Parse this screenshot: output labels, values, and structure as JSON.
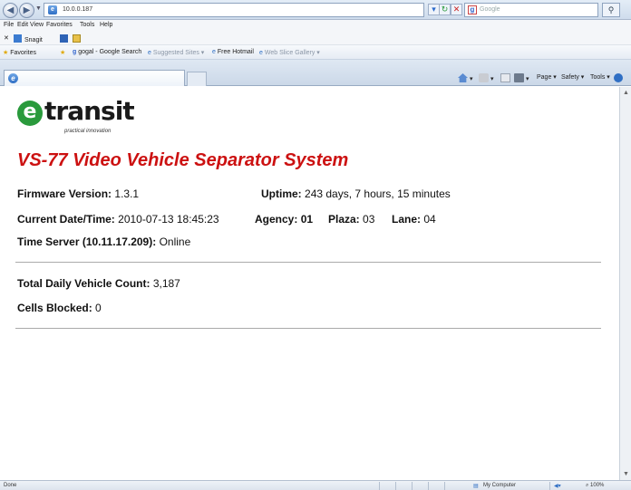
{
  "browser": {
    "address": "10.0.0.187",
    "search_placeholder": "Google",
    "menu": [
      "File",
      "Edit",
      "View",
      "Favorites",
      "Tools",
      "Help"
    ],
    "links_bar": {
      "snagit": "Snagit"
    },
    "favorites_bar": {
      "favorites": "Favorites",
      "google_search": "gogal - Google Search",
      "suggested_sites": "Suggested Sites ▾",
      "free_hotmail": "Free Hotmail",
      "web_slice_gallery": "Web Slice Gallery ▾"
    },
    "command_bar": {
      "page": "Page ▾",
      "safety": "Safety ▾",
      "tools": "Tools ▾"
    },
    "status": {
      "left": "Done",
      "zone": "My Computer",
      "zoom": "⌕ 100%"
    }
  },
  "page": {
    "logo_word": "transit",
    "logo_letter": "e",
    "logo_tagline": "practical innovation",
    "title": "VS-77 Video Vehicle Separator System",
    "firmware_label": "Firmware Version:",
    "firmware_value": "1.3.1",
    "uptime_label": "Uptime:",
    "uptime_value": "243 days, 7 hours, 15 minutes",
    "datetime_label": "Current Date/Time:",
    "datetime_value": "2010-07-13 18:45:23",
    "agency_label": "Agency:",
    "agency_value": "01",
    "plaza_label": "Plaza:",
    "plaza_value": "03",
    "lane_label": "Lane:",
    "lane_value": "04",
    "timeserver_label": "Time Server (10.11.17.209):",
    "timeserver_value": "Online",
    "vehicle_count_label": "Total Daily Vehicle Count:",
    "vehicle_count_value": "3,187",
    "cells_blocked_label": "Cells Blocked:",
    "cells_blocked_value": "0"
  },
  "colors": {
    "title_red": "#cc1111",
    "logo_green": "#2a9a3c"
  }
}
